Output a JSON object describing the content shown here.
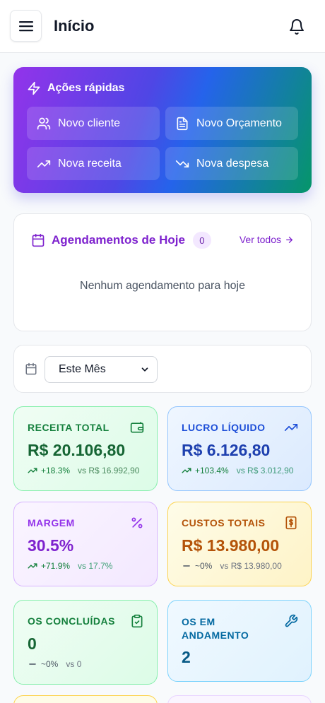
{
  "header": {
    "title": "Início"
  },
  "quick_actions": {
    "title": "Ações rápidas",
    "items": [
      {
        "label": "Novo cliente",
        "icon": "users-icon"
      },
      {
        "label": "Novo Orçamento",
        "icon": "document-icon"
      },
      {
        "label": "Nova receita",
        "icon": "trending-up-icon"
      },
      {
        "label": "Nova despesa",
        "icon": "trending-down-icon"
      }
    ]
  },
  "appointments": {
    "title": "Agendamentos de Hoje",
    "count": "0",
    "see_all": "Ver todos",
    "empty_message": "Nenhum agendamento para hoje"
  },
  "filter": {
    "selected_period": "Este Mês"
  },
  "stats": {
    "receita": {
      "label": "RECEITA TOTAL",
      "value": "R$ 20.106,80",
      "change": "+18.3%",
      "compare": "vs R$ 16.992,90",
      "icon": "wallet-icon"
    },
    "lucro": {
      "label": "LUCRO LÍQUIDO",
      "value": "R$ 6.126,80",
      "change": "+103.4%",
      "compare": "vs R$ 3.012,90",
      "icon": "trending-up-icon"
    },
    "margem": {
      "label": "MARGEM",
      "value": "30.5%",
      "change": "+71.9%",
      "compare": "vs 17.7%",
      "icon": "percent-icon"
    },
    "custos": {
      "label": "CUSTOS TOTAIS",
      "value": "R$ 13.980,00",
      "change": "~0%",
      "compare": "vs R$ 13.980,00",
      "icon": "receipt-dollar-icon"
    },
    "os_concluidas": {
      "label": "OS CONCLUÍDAS",
      "value": "0",
      "change": "~0%",
      "compare": "vs 0",
      "icon": "clipboard-check-icon"
    },
    "os_andamento": {
      "label_line1": "OS EM",
      "label_line2": "ANDAMENTO",
      "value": "2",
      "icon": "wrench-icon"
    }
  },
  "colors": {
    "accent_purple": "#7e22ce",
    "green": "#15803d",
    "blue": "#1d4ed8",
    "amber": "#b45309",
    "sky": "#0369a1"
  }
}
